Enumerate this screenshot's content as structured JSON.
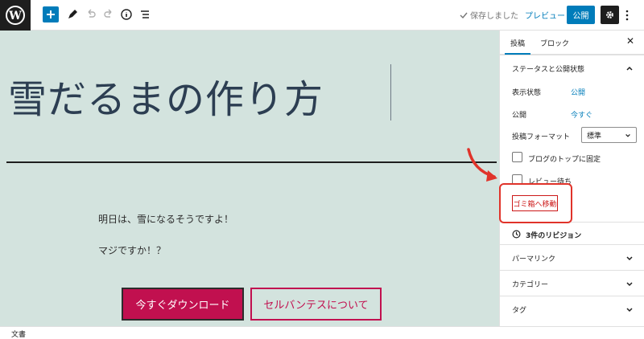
{
  "toolbar": {
    "save_status": "保存しました",
    "preview_label": "プレビュー",
    "publish_label": "公開",
    "icons": [
      "wordpress-logo-icon",
      "plus-icon",
      "pencil-icon",
      "undo-icon",
      "redo-icon",
      "info-icon",
      "list-view-icon",
      "checkmark-icon",
      "gear-icon",
      "kebab-menu-icon"
    ]
  },
  "editor": {
    "title": "雪だるまの作り方",
    "paragraphs": [
      "明日は、雪になるそうですよ！",
      "マジですか！？"
    ],
    "buttons": {
      "primary": "今すぐダウンロード",
      "secondary": "セルバンテスについて"
    },
    "colors": {
      "canvas_bg": "#d3e3de",
      "button_accent": "#c1104f"
    }
  },
  "sidebar": {
    "tabs": [
      {
        "label": "投稿",
        "active": true
      },
      {
        "label": "ブロック",
        "active": false
      }
    ],
    "status_panel": {
      "title": "ステータスと公開状態",
      "visibility_label": "表示状態",
      "visibility_value": "公開",
      "publish_label": "公開",
      "publish_value": "今すぐ",
      "format_label": "投稿フォーマット",
      "format_value": "標準",
      "sticky_label": "ブログのトップに固定",
      "pending_label": "レビュー待ち",
      "trash_label": "ゴミ箱へ移動"
    },
    "revisions_label": "3件のリビジョン",
    "panels": [
      "パーマリンク",
      "カテゴリー",
      "タグ"
    ]
  },
  "statusbar": {
    "label": "文書"
  }
}
